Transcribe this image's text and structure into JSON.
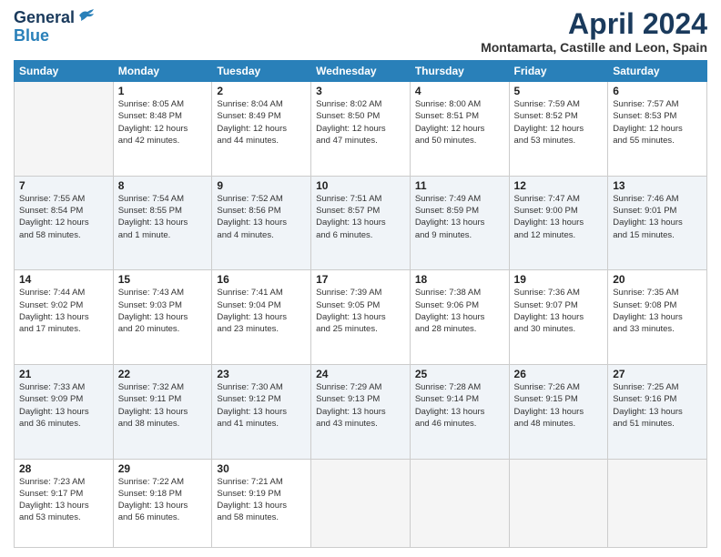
{
  "header": {
    "logo_line1": "General",
    "logo_line2": "Blue",
    "month_title": "April 2024",
    "location": "Montamarta, Castille and Leon, Spain"
  },
  "weekdays": [
    "Sunday",
    "Monday",
    "Tuesday",
    "Wednesday",
    "Thursday",
    "Friday",
    "Saturday"
  ],
  "weeks": [
    [
      {
        "day": "",
        "info": ""
      },
      {
        "day": "1",
        "info": "Sunrise: 8:05 AM\nSunset: 8:48 PM\nDaylight: 12 hours\nand 42 minutes."
      },
      {
        "day": "2",
        "info": "Sunrise: 8:04 AM\nSunset: 8:49 PM\nDaylight: 12 hours\nand 44 minutes."
      },
      {
        "day": "3",
        "info": "Sunrise: 8:02 AM\nSunset: 8:50 PM\nDaylight: 12 hours\nand 47 minutes."
      },
      {
        "day": "4",
        "info": "Sunrise: 8:00 AM\nSunset: 8:51 PM\nDaylight: 12 hours\nand 50 minutes."
      },
      {
        "day": "5",
        "info": "Sunrise: 7:59 AM\nSunset: 8:52 PM\nDaylight: 12 hours\nand 53 minutes."
      },
      {
        "day": "6",
        "info": "Sunrise: 7:57 AM\nSunset: 8:53 PM\nDaylight: 12 hours\nand 55 minutes."
      }
    ],
    [
      {
        "day": "7",
        "info": "Sunrise: 7:55 AM\nSunset: 8:54 PM\nDaylight: 12 hours\nand 58 minutes."
      },
      {
        "day": "8",
        "info": "Sunrise: 7:54 AM\nSunset: 8:55 PM\nDaylight: 13 hours\nand 1 minute."
      },
      {
        "day": "9",
        "info": "Sunrise: 7:52 AM\nSunset: 8:56 PM\nDaylight: 13 hours\nand 4 minutes."
      },
      {
        "day": "10",
        "info": "Sunrise: 7:51 AM\nSunset: 8:57 PM\nDaylight: 13 hours\nand 6 minutes."
      },
      {
        "day": "11",
        "info": "Sunrise: 7:49 AM\nSunset: 8:59 PM\nDaylight: 13 hours\nand 9 minutes."
      },
      {
        "day": "12",
        "info": "Sunrise: 7:47 AM\nSunset: 9:00 PM\nDaylight: 13 hours\nand 12 minutes."
      },
      {
        "day": "13",
        "info": "Sunrise: 7:46 AM\nSunset: 9:01 PM\nDaylight: 13 hours\nand 15 minutes."
      }
    ],
    [
      {
        "day": "14",
        "info": "Sunrise: 7:44 AM\nSunset: 9:02 PM\nDaylight: 13 hours\nand 17 minutes."
      },
      {
        "day": "15",
        "info": "Sunrise: 7:43 AM\nSunset: 9:03 PM\nDaylight: 13 hours\nand 20 minutes."
      },
      {
        "day": "16",
        "info": "Sunrise: 7:41 AM\nSunset: 9:04 PM\nDaylight: 13 hours\nand 23 minutes."
      },
      {
        "day": "17",
        "info": "Sunrise: 7:39 AM\nSunset: 9:05 PM\nDaylight: 13 hours\nand 25 minutes."
      },
      {
        "day": "18",
        "info": "Sunrise: 7:38 AM\nSunset: 9:06 PM\nDaylight: 13 hours\nand 28 minutes."
      },
      {
        "day": "19",
        "info": "Sunrise: 7:36 AM\nSunset: 9:07 PM\nDaylight: 13 hours\nand 30 minutes."
      },
      {
        "day": "20",
        "info": "Sunrise: 7:35 AM\nSunset: 9:08 PM\nDaylight: 13 hours\nand 33 minutes."
      }
    ],
    [
      {
        "day": "21",
        "info": "Sunrise: 7:33 AM\nSunset: 9:09 PM\nDaylight: 13 hours\nand 36 minutes."
      },
      {
        "day": "22",
        "info": "Sunrise: 7:32 AM\nSunset: 9:11 PM\nDaylight: 13 hours\nand 38 minutes."
      },
      {
        "day": "23",
        "info": "Sunrise: 7:30 AM\nSunset: 9:12 PM\nDaylight: 13 hours\nand 41 minutes."
      },
      {
        "day": "24",
        "info": "Sunrise: 7:29 AM\nSunset: 9:13 PM\nDaylight: 13 hours\nand 43 minutes."
      },
      {
        "day": "25",
        "info": "Sunrise: 7:28 AM\nSunset: 9:14 PM\nDaylight: 13 hours\nand 46 minutes."
      },
      {
        "day": "26",
        "info": "Sunrise: 7:26 AM\nSunset: 9:15 PM\nDaylight: 13 hours\nand 48 minutes."
      },
      {
        "day": "27",
        "info": "Sunrise: 7:25 AM\nSunset: 9:16 PM\nDaylight: 13 hours\nand 51 minutes."
      }
    ],
    [
      {
        "day": "28",
        "info": "Sunrise: 7:23 AM\nSunset: 9:17 PM\nDaylight: 13 hours\nand 53 minutes."
      },
      {
        "day": "29",
        "info": "Sunrise: 7:22 AM\nSunset: 9:18 PM\nDaylight: 13 hours\nand 56 minutes."
      },
      {
        "day": "30",
        "info": "Sunrise: 7:21 AM\nSunset: 9:19 PM\nDaylight: 13 hours\nand 58 minutes."
      },
      {
        "day": "",
        "info": ""
      },
      {
        "day": "",
        "info": ""
      },
      {
        "day": "",
        "info": ""
      },
      {
        "day": "",
        "info": ""
      }
    ]
  ]
}
